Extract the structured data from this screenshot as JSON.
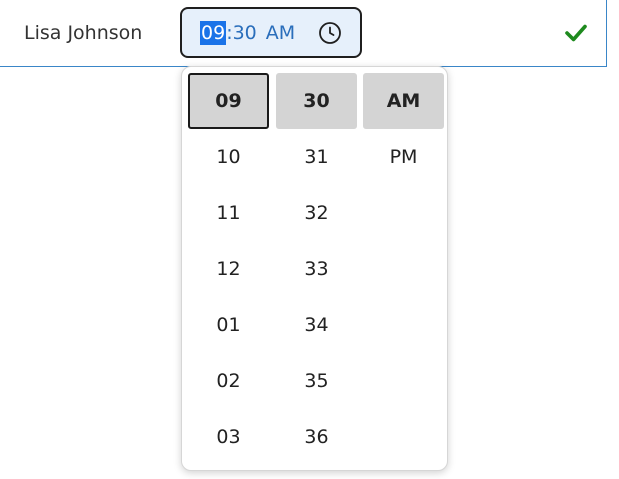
{
  "row": {
    "name": "Lisa Johnson",
    "time_input": {
      "hour": "09",
      "separator": ":",
      "minute": "30",
      "period": "AM"
    },
    "status_color": "#1e8a1e"
  },
  "picker": {
    "hours": [
      "09",
      "10",
      "11",
      "12",
      "01",
      "02",
      "03"
    ],
    "minutes": [
      "30",
      "31",
      "32",
      "33",
      "34",
      "35",
      "36"
    ],
    "periods": [
      "AM",
      "PM"
    ],
    "selected": {
      "hour": "09",
      "minute": "30",
      "period": "AM"
    },
    "focused_column": "hours"
  }
}
